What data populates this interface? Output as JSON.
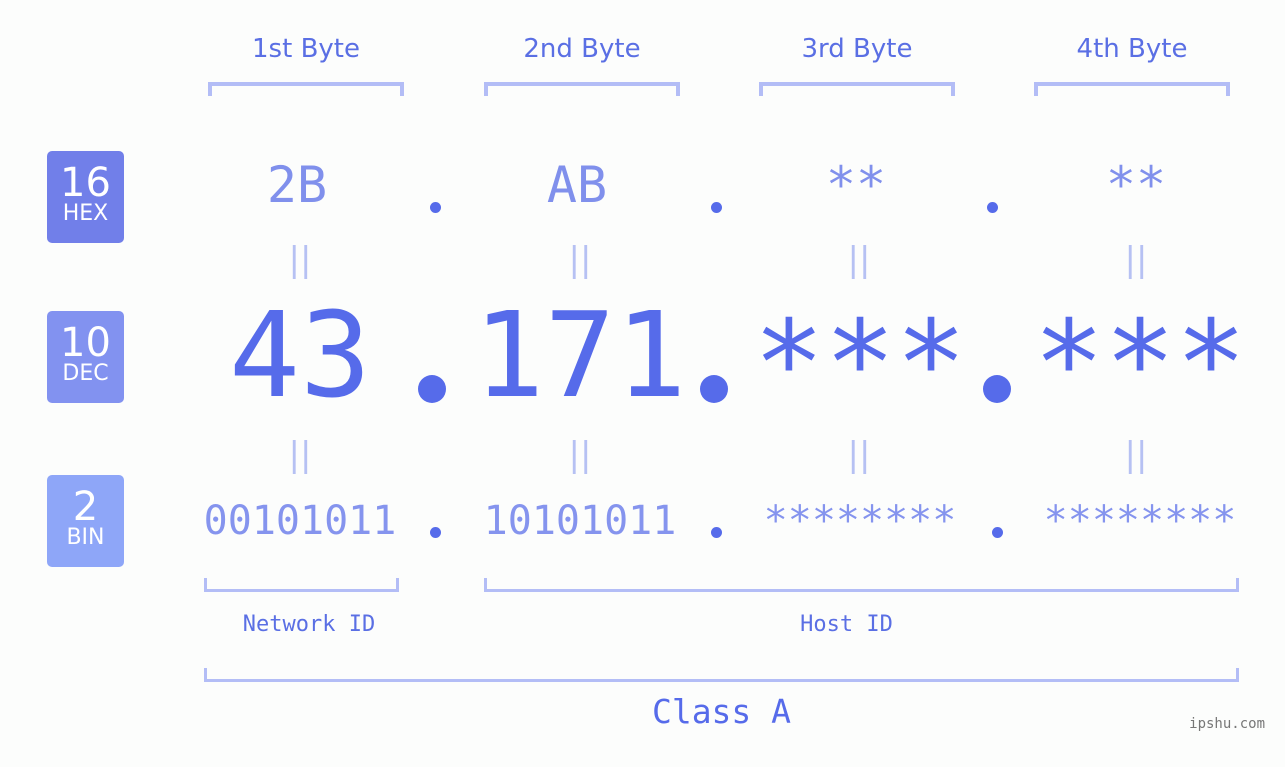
{
  "bytes_header": [
    "1st Byte",
    "2nd Byte",
    "3rd Byte",
    "4th Byte"
  ],
  "bases": [
    {
      "number": "16",
      "label": "HEX",
      "color": "#717fe9"
    },
    {
      "number": "10",
      "label": "DEC",
      "color": "#8292f0"
    },
    {
      "number": "2",
      "label": "BIN",
      "color": "#8ea6f8"
    }
  ],
  "hex": [
    "2B",
    "AB",
    "**",
    "**"
  ],
  "dec": [
    "43",
    "171",
    "***",
    "***"
  ],
  "bin": [
    "00101011",
    "10101011",
    "********",
    "********"
  ],
  "equals": "||",
  "labels": {
    "network_id": "Network ID",
    "host_id": "Host ID",
    "class": "Class A"
  },
  "watermark": "ipshu.com",
  "colors": {
    "accent": "#566bea",
    "bracket": "#b3bdf6",
    "background": "#fcfdfc"
  }
}
